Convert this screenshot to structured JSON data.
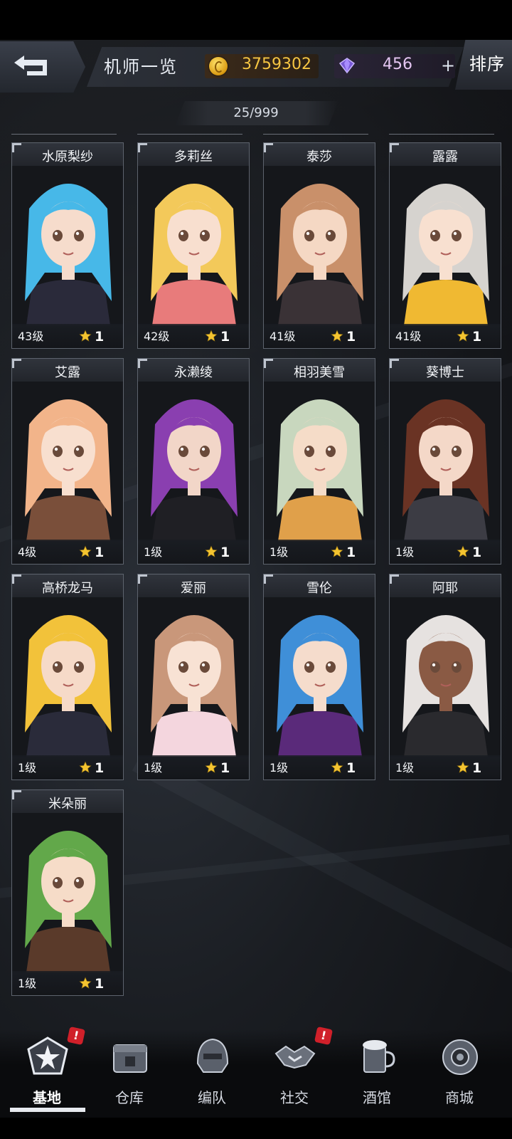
{
  "header": {
    "title": "机师一览",
    "gold": "3759302",
    "gems": "456",
    "add_symbol": "+",
    "sort_label": "排序",
    "counter": "25/999"
  },
  "pilots": [
    {
      "name": "水原梨纱",
      "level": "43级",
      "stars": "1",
      "hair": "#47b8e8",
      "skin": "#f6dccc",
      "outfit": "#2a2a3a"
    },
    {
      "name": "多莉丝",
      "level": "42级",
      "stars": "1",
      "hair": "#f3c95a",
      "skin": "#f8dfcf",
      "outfit": "#e87b7b"
    },
    {
      "name": "泰莎",
      "level": "41级",
      "stars": "1",
      "hair": "#c9906a",
      "skin": "#f5d8c4",
      "outfit": "#3a3236"
    },
    {
      "name": "露露",
      "level": "41级",
      "stars": "1",
      "hair": "#d6d3cf",
      "skin": "#f8e0d0",
      "outfit": "#f0b932"
    },
    {
      "name": "艾露",
      "level": "4级",
      "stars": "1",
      "hair": "#f2b48a",
      "skin": "#f8dfcf",
      "outfit": "#7a4f3a"
    },
    {
      "name": "永濑绫",
      "level": "1级",
      "stars": "1",
      "hair": "#8a3fb0",
      "skin": "#f2d6c8",
      "outfit": "#1f1f24"
    },
    {
      "name": "相羽美雪",
      "level": "1级",
      "stars": "1",
      "hair": "#c8d7be",
      "skin": "#f5dcc8",
      "outfit": "#e0a04a"
    },
    {
      "name": "葵博士",
      "level": "1级",
      "stars": "1",
      "hair": "#6a3324",
      "skin": "#f4d8c8",
      "outfit": "#3c3c44"
    },
    {
      "name": "高桥龙马",
      "level": "1级",
      "stars": "1",
      "hair": "#f2c23a",
      "skin": "#f6dac8",
      "outfit": "#2a2b3a"
    },
    {
      "name": "爱丽",
      "level": "1级",
      "stars": "1",
      "hair": "#c9977a",
      "skin": "#f8e2d4",
      "outfit": "#f4d6de"
    },
    {
      "name": "雪伦",
      "level": "1级",
      "stars": "1",
      "hair": "#3f8fd8",
      "skin": "#f5dccc",
      "outfit": "#5a2a7a"
    },
    {
      "name": "阿耶",
      "level": "1级",
      "stars": "1",
      "hair": "#e6e2e0",
      "skin": "#8a5a44",
      "outfit": "#2a2a2e"
    },
    {
      "name": "米朵丽",
      "level": "1级",
      "stars": "1",
      "hair": "#62a84a",
      "skin": "#f6dcc8",
      "outfit": "#5a3a2a"
    }
  ],
  "nav": [
    {
      "label": "基地",
      "icon": "base-emblem-icon",
      "active": true,
      "badge": "!"
    },
    {
      "label": "仓库",
      "icon": "warehouse-crate-icon",
      "active": false
    },
    {
      "label": "编队",
      "icon": "mech-helmet-icon",
      "active": false
    },
    {
      "label": "社交",
      "icon": "handshake-icon",
      "active": false,
      "badge": "!"
    },
    {
      "label": "酒馆",
      "icon": "beer-mug-icon",
      "active": false
    },
    {
      "label": "商城",
      "icon": "shop-orb-icon",
      "active": false
    }
  ],
  "colors": {
    "gold_text": "#f5c542",
    "gem_text": "#e5c6f2",
    "star": "#f4c430",
    "badge": "#d0202a"
  }
}
